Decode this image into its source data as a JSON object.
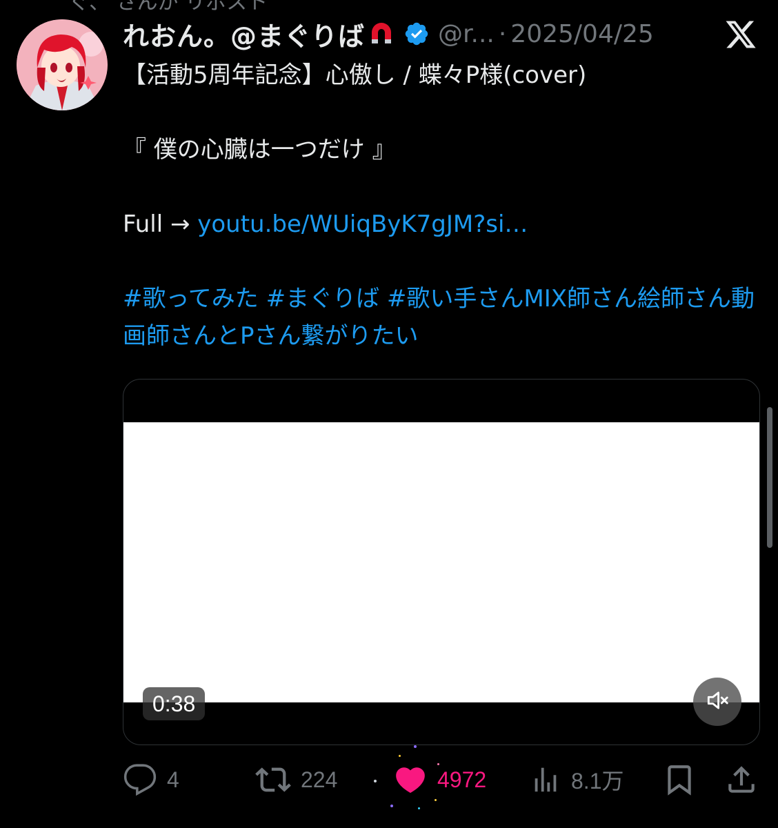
{
  "colors": {
    "link": "#1d9bf0",
    "like": "#f91880",
    "muted": "#71767b",
    "text": "#e7e9ea"
  },
  "top_cut_text": "ぐ、 さんが リポスト",
  "author": {
    "display_name": "れおん。@まぐりば",
    "emoji": "magnet-icon",
    "handle": "@r...",
    "date": "2025/04/25"
  },
  "tweet": {
    "line1": "【活動5周年記念】心傲し / 蝶々P様(cover)",
    "line2": "『 僕の心臓は一つだけ 』",
    "full_prefix": "Full → ",
    "link_text": "youtu.be/WUiqByK7gJM?si…",
    "hashtags": "#歌ってみた #まぐりば #歌い手さんMIX師さん絵師さん動画師さんとPさん繋がりたい"
  },
  "video": {
    "duration": "0:38",
    "mute_icon": "speaker-muted-icon"
  },
  "actions": {
    "replies": "4",
    "reposts": "224",
    "likes": "4972",
    "views": "8.1万"
  }
}
